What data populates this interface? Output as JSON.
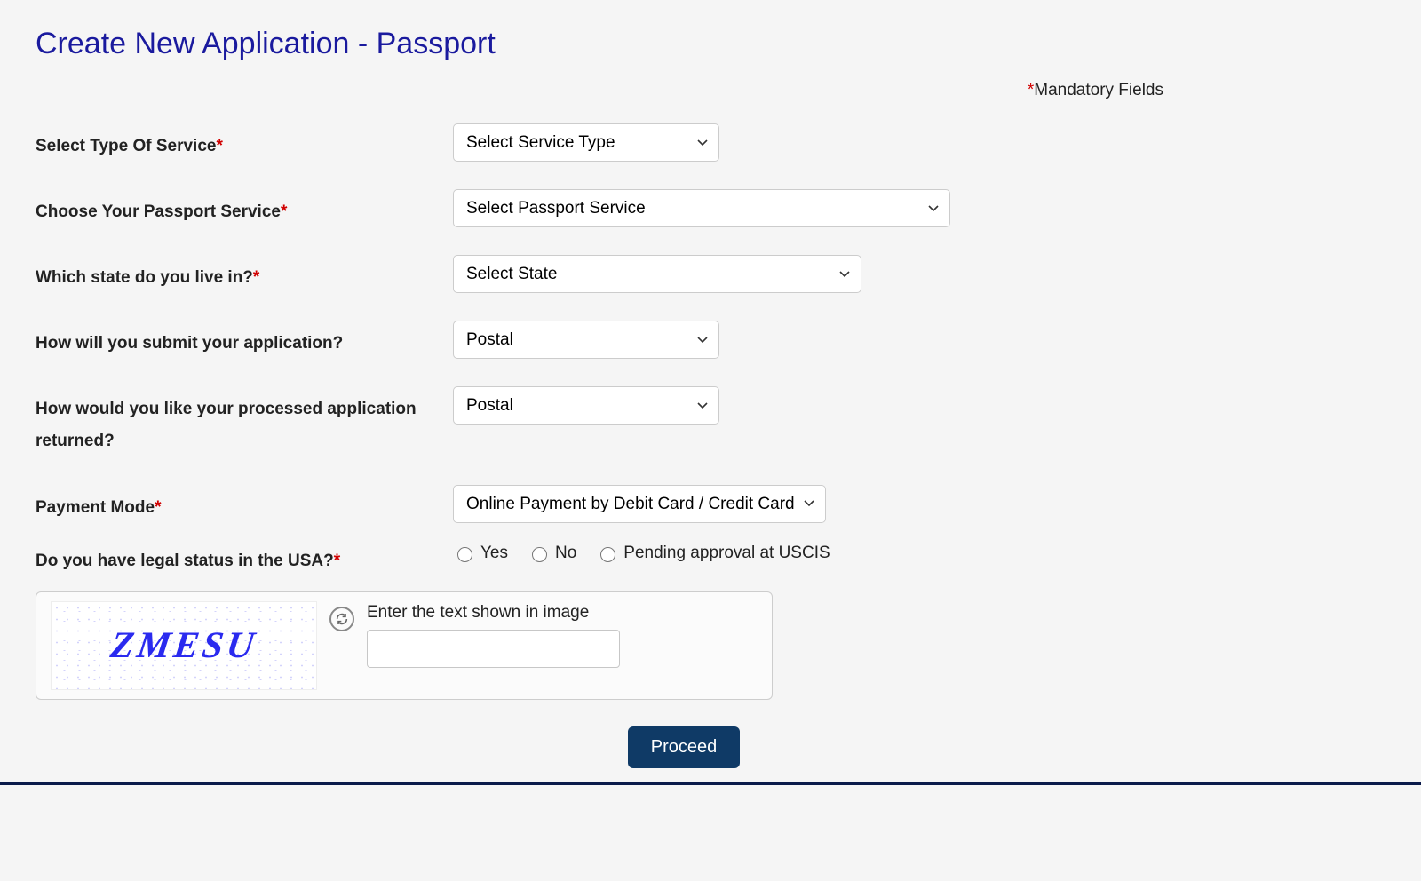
{
  "page_title": "Create New Application - Passport",
  "mandatory_label": "Mandatory Fields",
  "fields": {
    "service_type": {
      "label": "Select Type Of Service",
      "required": true,
      "value": "Select Service Type"
    },
    "passport_service": {
      "label": "Choose Your Passport Service",
      "required": true,
      "value": "Select Passport Service"
    },
    "state": {
      "label": "Which state do you live in?",
      "required": true,
      "value": "Select State"
    },
    "submit_method": {
      "label": "How will you submit your application?",
      "required": false,
      "value": "Postal"
    },
    "return_method": {
      "label": "How would you like your processed application returned?",
      "required": false,
      "value": "Postal"
    },
    "payment_mode": {
      "label": "Payment Mode",
      "required": true,
      "value": "Online Payment by Debit Card / Credit Card"
    },
    "legal_status": {
      "label": "Do you have legal status in the USA?",
      "required": true,
      "options": {
        "yes": "Yes",
        "no": "No",
        "pending": "Pending approval at USCIS"
      }
    }
  },
  "captcha": {
    "text": "ZMESU",
    "prompt": "Enter the text shown in image"
  },
  "proceed_label": "Proceed"
}
